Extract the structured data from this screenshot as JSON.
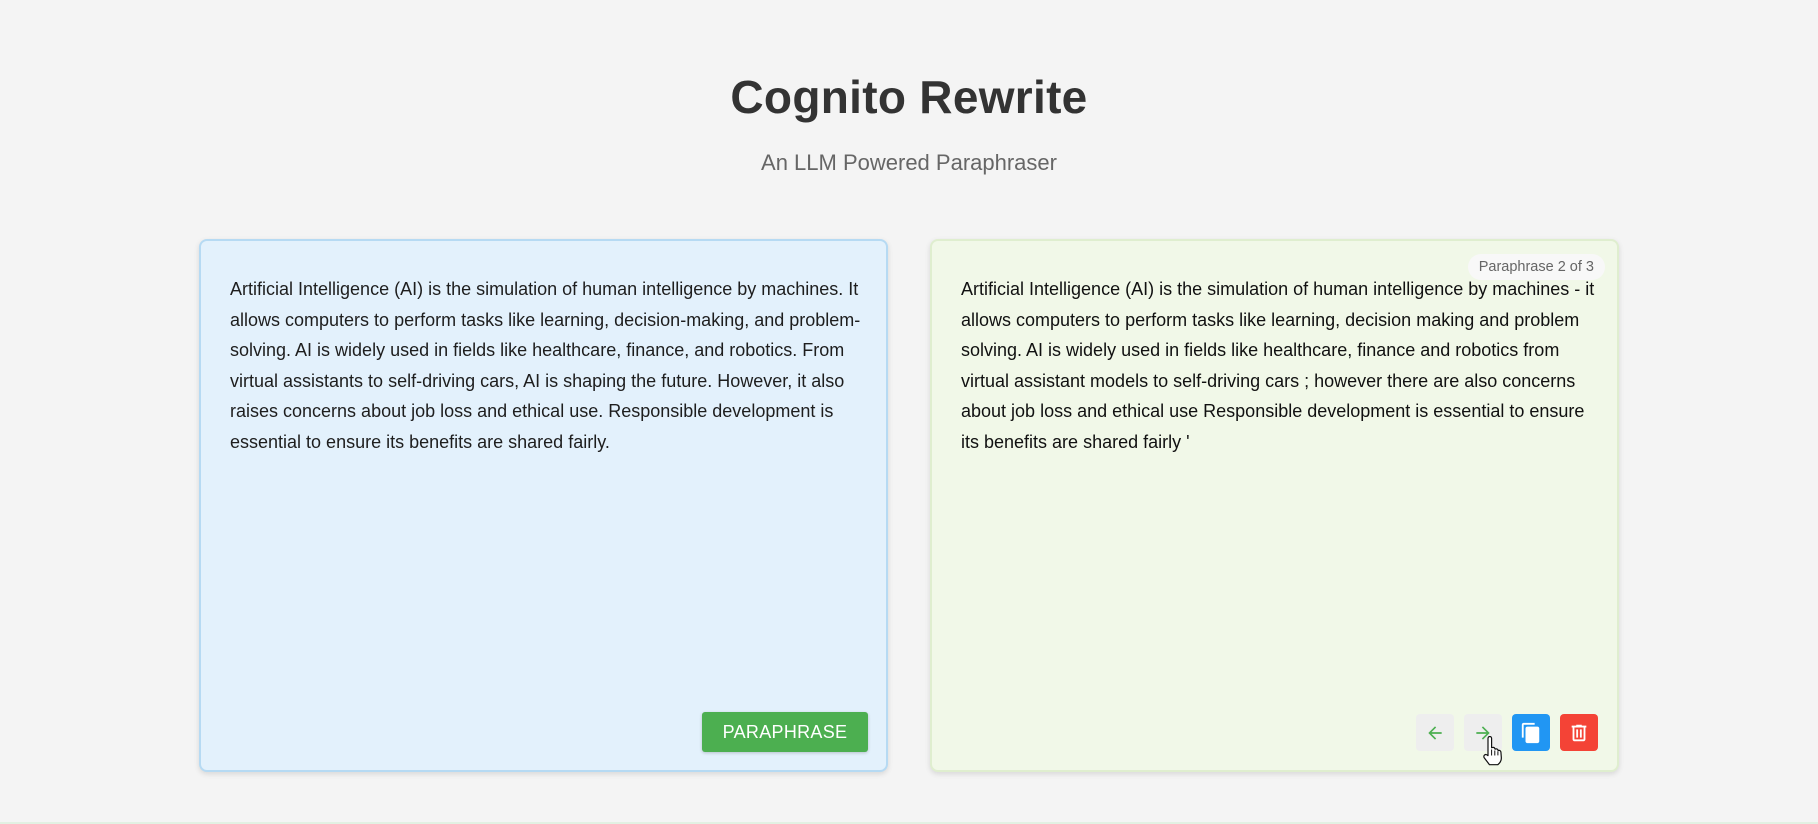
{
  "header": {
    "title": "Cognito Rewrite",
    "subtitle": "An LLM Powered Paraphraser"
  },
  "input_panel": {
    "text": "Artificial Intelligence (AI) is the simulation of human intelligence by machines. It allows computers to perform tasks like learning, decision-making, and problem-solving. AI is widely used in fields like healthcare, finance, and robotics. From virtual assistants to self-driving cars, AI is shaping the future. However, it also raises concerns about job loss and ethical use. Responsible development is essential to ensure its benefits are shared fairly.",
    "paraphrase_label": "PARAPHRASE",
    "background_color": "#e3f1fc",
    "button_color": "#4caf50"
  },
  "output_panel": {
    "counter": "Paraphrase 2 of 3",
    "text": "Artificial Intelligence (AI) is the simulation of human intelligence by machines - it allows computers to perform tasks like learning, decision making and problem solving. AI is widely used in fields like healthcare, finance and robotics from virtual assistant models to self-driving cars ; however there are also concerns about job loss and ethical use Responsible development is essential to ensure its benefits are shared fairly '",
    "background_color": "#f1f8e8",
    "actions": {
      "prev_icon": "arrow-left-icon",
      "next_icon": "arrow-right-icon",
      "copy_icon": "copy-icon",
      "delete_icon": "trash-icon",
      "copy_color": "#2196f3",
      "delete_color": "#f44336"
    }
  }
}
